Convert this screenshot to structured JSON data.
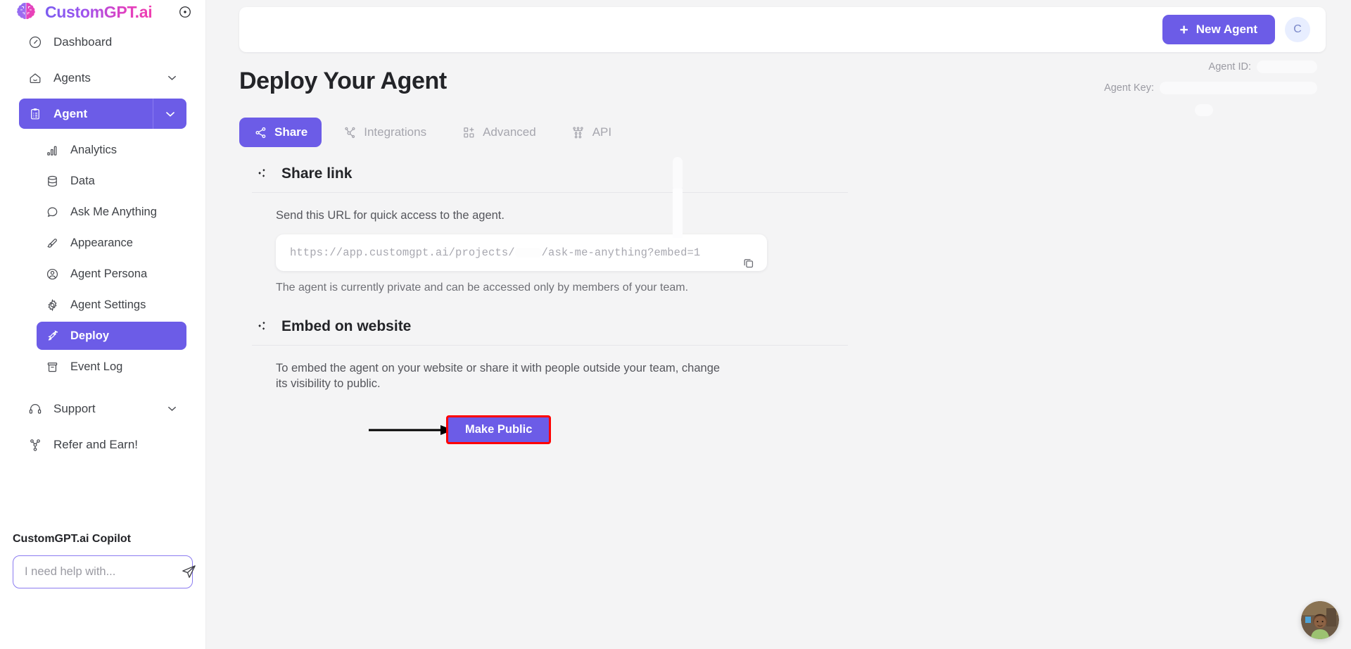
{
  "brand": {
    "name": "CustomGPT.ai",
    "logo_icon": "brain-logo-icon",
    "collapse_icon": "sidebar-collapse-icon"
  },
  "colors": {
    "accent": "#6c5ce7",
    "annotation": "#ff0000",
    "page_bg": "#f4f4f5",
    "panel_bg": "#ffffff",
    "text": "#3f4247",
    "muted": "#a6a6ae"
  },
  "sidebar": {
    "items": [
      {
        "label": "Dashboard",
        "icon": "dashboard-gauge-icon",
        "has_chevron": false,
        "active": false
      },
      {
        "label": "Agents",
        "icon": "agents-home-icon",
        "has_chevron": true,
        "active": false
      },
      {
        "label": "Agent",
        "icon": "agent-clipboard-icon",
        "has_chevron": true,
        "active": true
      }
    ],
    "sub_items": [
      {
        "label": "Analytics",
        "icon": "analytics-bars-icon",
        "active": false
      },
      {
        "label": "Data",
        "icon": "data-database-icon",
        "active": false
      },
      {
        "label": "Ask Me Anything",
        "icon": "chat-bubble-icon",
        "active": false
      },
      {
        "label": "Appearance",
        "icon": "appearance-brush-icon",
        "active": false
      },
      {
        "label": "Agent Persona",
        "icon": "persona-user-circle-icon",
        "active": false
      },
      {
        "label": "Agent Settings",
        "icon": "settings-gear-icon",
        "active": false
      },
      {
        "label": "Deploy",
        "icon": "deploy-rocket-icon",
        "active": true
      },
      {
        "label": "Event Log",
        "icon": "event-log-archive-icon",
        "active": false
      }
    ],
    "footer_items": [
      {
        "label": "Support",
        "icon": "support-headset-icon",
        "has_chevron": true
      },
      {
        "label": "Refer and Earn!",
        "icon": "refer-share-icon",
        "has_chevron": false
      }
    ],
    "copilot": {
      "title": "CustomGPT.ai Copilot",
      "placeholder": "I need help with...",
      "value": "",
      "send_icon": "send-paper-plane-icon"
    }
  },
  "topbar": {
    "new_agent_label": "New Agent",
    "new_agent_plus": "+",
    "avatar_initial": "C"
  },
  "page": {
    "title": "Deploy Your Agent",
    "agent_id_label": "Agent ID:",
    "agent_id_value": "",
    "agent_key_label": "Agent Key:",
    "agent_key_value": ""
  },
  "tabs": [
    {
      "label": "Share",
      "icon": "share-nodes-icon",
      "active": true
    },
    {
      "label": "Integrations",
      "icon": "integrations-nodes-icon",
      "active": false
    },
    {
      "label": "Advanced",
      "icon": "advanced-grid-plus-icon",
      "active": false
    },
    {
      "label": "API",
      "icon": "api-tree-icon",
      "active": false
    }
  ],
  "share_section": {
    "icon": "diamonds-sparkle-icon",
    "title": "Share link",
    "description": "Send this URL for quick access to the agent.",
    "url_prefix": "https://app.customgpt.ai/projects/",
    "url_suffix": "/ask-me-anything?embed=1",
    "url_redacted": true,
    "copy_icon": "copy-icon",
    "status_note": "The agent is currently private and can be accessed only by members of your team."
  },
  "embed_section": {
    "icon": "diamonds-sparkle-icon",
    "title": "Embed on website",
    "description": "To embed the agent on your website or share it with people outside your team, change its visibility to public.",
    "make_public_label": "Make Public",
    "annotation": {
      "type": "arrow-and-box",
      "color": "#ff0000",
      "target": "make-public-button"
    }
  },
  "chat_widget": {
    "launcher_icon": "chat-avatar-launcher"
  }
}
